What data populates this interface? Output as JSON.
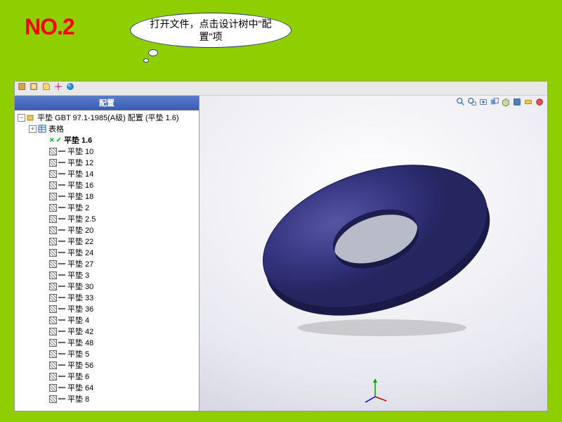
{
  "header": {
    "step_number": "NO.2",
    "instruction": "打开文件，点击设计树中\"配置\"项"
  },
  "sidebar": {
    "title": "配置",
    "root_label": "平垫  GBT 97.1-1985(A级) 配置  (平垫 1.6)",
    "table_label": "表格",
    "items": [
      {
        "label": "平垫 1.6",
        "active": true
      },
      {
        "label": "平垫 10"
      },
      {
        "label": "平垫 12"
      },
      {
        "label": "平垫 14"
      },
      {
        "label": "平垫 16"
      },
      {
        "label": "平垫 18"
      },
      {
        "label": "平垫 2"
      },
      {
        "label": "平垫 2.5"
      },
      {
        "label": "平垫 20"
      },
      {
        "label": "平垫 22"
      },
      {
        "label": "平垫 24"
      },
      {
        "label": "平垫 27"
      },
      {
        "label": "平垫 3"
      },
      {
        "label": "平垫 30"
      },
      {
        "label": "平垫 33"
      },
      {
        "label": "平垫 36"
      },
      {
        "label": "平垫 4"
      },
      {
        "label": "平垫 42"
      },
      {
        "label": "平垫 48"
      },
      {
        "label": "平垫 5"
      },
      {
        "label": "平垫 56"
      },
      {
        "label": "平垫 6"
      },
      {
        "label": "平垫 64"
      },
      {
        "label": "平垫 8"
      }
    ]
  },
  "colors": {
    "washer": "#2d2d6b",
    "washer_light": "#4a4a95"
  }
}
